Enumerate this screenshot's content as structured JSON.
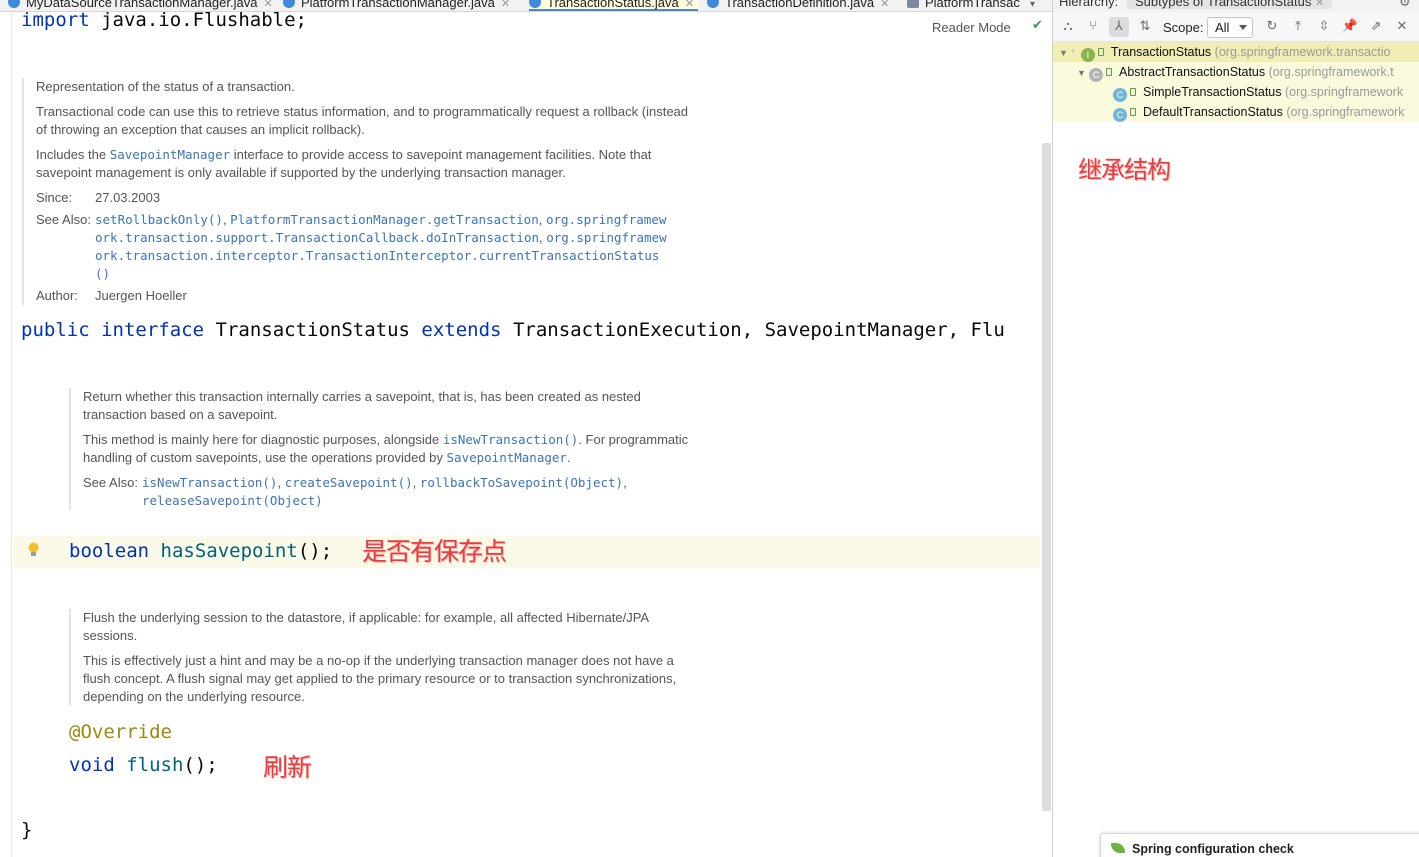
{
  "tabs": [
    {
      "label": "MyDataSourceTransactionManager.java",
      "active": false
    },
    {
      "label": "PlatformTransactionManager.java",
      "active": false
    },
    {
      "label": "TransactionStatus.java",
      "active": true
    },
    {
      "label": "TransactionDefinition.java",
      "active": false
    },
    {
      "label": "PlatformTransac",
      "active": false
    }
  ],
  "editor": {
    "reader_mode_label": "Reader Mode",
    "import_line": {
      "keyword": "import",
      "rest": " java.io.Flushable;"
    },
    "class_doc": {
      "p1": "Representation of the status of a transaction.",
      "p2": "Transactional code can use this to retrieve status information, and to programmatically request a rollback (instead of throwing an exception that causes an implicit rollback).",
      "p3_pre": "Includes the ",
      "p3_link": "SavepointManager",
      "p3_post": " interface to provide access to savepoint management facilities. Note that savepoint management is only available if supported by the underlying transaction manager.",
      "since_label": "Since:",
      "since_value": "27.03.2003",
      "see_also_label": "See Also:",
      "see_also_links": [
        "setRollbackOnly()",
        "PlatformTransactionManager.getTransaction",
        "org.springframework.transaction.support.TransactionCallback.doInTransaction",
        "org.springframework.transaction.interceptor.TransactionInterceptor.currentTransactionStatus()"
      ],
      "author_label": "Author:",
      "author_value": "Juergen Hoeller"
    },
    "interface_decl": {
      "kw_public": "public",
      "kw_interface": "interface",
      "name": "TransactionStatus",
      "kw_extends": "extends",
      "supertypes": "TransactionExecution, SavepointManager, Flu"
    },
    "has_savepoint_doc": {
      "p1": "Return whether this transaction internally carries a savepoint, that is, has been created as nested transaction based on a savepoint.",
      "p2_pre": "This method is mainly here for diagnostic purposes, alongside ",
      "p2_link1": "isNewTransaction()",
      "p2_mid": ". For programmatic handling of custom savepoints, use the operations provided by ",
      "p2_link2": "SavepointManager",
      "p2_post": ".",
      "see_also_label": "See Also:",
      "see_also_links": [
        "isNewTransaction()",
        "createSavepoint()",
        "rollbackToSavepoint(Object)",
        "releaseSavepoint(Object)"
      ]
    },
    "has_savepoint_line": {
      "type": "boolean",
      "name": "hasSavepoint",
      "tail": "();"
    },
    "has_savepoint_note": "是否有保存点",
    "flush_doc": {
      "p1": "Flush the underlying session to the datastore, if applicable: for example, all affected Hibernate/JPA sessions.",
      "p2": "This is effectively just a hint and may be a no-op if the underlying transaction manager does not have a flush concept. A flush signal may get applied to the primary resource or to transaction synchronizations, depending on the underlying resource."
    },
    "override_annotation": "@Override",
    "flush_line": {
      "type": "void",
      "name": "flush",
      "tail": "();"
    },
    "flush_note": "刷新",
    "closing_brace": "}"
  },
  "hierarchy": {
    "title": "Hierarchy:",
    "tab_label": "Subtypes of TransactionStatus",
    "scope_label": "Scope:",
    "scope_value": "All",
    "nodes": [
      {
        "name": "TransactionStatus",
        "package": "(org.springframework.transactio",
        "kind": "interface"
      },
      {
        "name": "AbstractTransactionStatus",
        "package": "(org.springframework.t",
        "kind": "abstract-class"
      },
      {
        "name": "SimpleTransactionStatus",
        "package": "(org.springframework",
        "kind": "class"
      },
      {
        "name": "DefaultTransactionStatus",
        "package": "(org.springframework",
        "kind": "class"
      }
    ],
    "note": "继承结构",
    "spring_check_label": "Spring configuration check"
  },
  "colors": {
    "keyword": "#0033b3",
    "annotation": "#9e880d",
    "method": "#00627a",
    "doc_link": "#3c74b8",
    "note_red": "#ea3c3c",
    "tree_highlight": "#fbfadc"
  }
}
